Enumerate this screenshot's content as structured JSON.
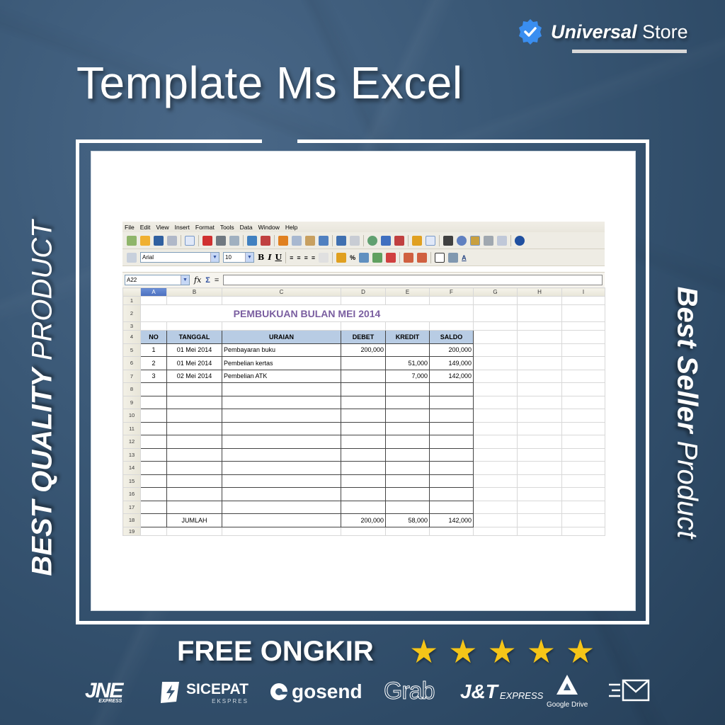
{
  "brand": {
    "name_bold": "Universal",
    "name_light": "Store",
    "badge_color": "#3a8ef0"
  },
  "title": "Template Ms Excel",
  "side_left": {
    "bold": "BEST QUALITY",
    "light": "PRODUCT"
  },
  "side_right": {
    "bold": "Best Seller",
    "light": "Product"
  },
  "spreadsheet": {
    "menu": [
      "File",
      "Edit",
      "View",
      "Insert",
      "Format",
      "Tools",
      "Data",
      "Window",
      "Help"
    ],
    "font_name": "Arial",
    "font_size": "10",
    "name_box": "A22",
    "formula_symbols": {
      "function": "fx",
      "sum": "Σ",
      "equals": "="
    },
    "columns": [
      "A",
      "B",
      "C",
      "D",
      "E",
      "F",
      "G",
      "H",
      "I"
    ],
    "selected_column": "A",
    "sheet_title": "PEMBUKUAN BULAN  MEI 2014",
    "headers": [
      "NO",
      "TANGGAL",
      "URAIAN",
      "DEBET",
      "KREDIT",
      "SALDO"
    ],
    "rows": [
      {
        "no": "1",
        "tanggal": "01 Mei 2014",
        "uraian": "Pembayaran buku",
        "debet": "200,000",
        "kredit": "",
        "saldo": "200,000"
      },
      {
        "no": "2",
        "tanggal": "01 Mei 2014",
        "uraian": "Pembelian kertas",
        "debet": "",
        "kredit": "51,000",
        "saldo": "149,000"
      },
      {
        "no": "3",
        "tanggal": "02 Mei 2014",
        "uraian": "Pembelian ATK",
        "debet": "",
        "kredit": "7,000",
        "saldo": "142,000"
      }
    ],
    "total": {
      "label": "JUMLAH",
      "debet": "200,000",
      "kredit": "58,000",
      "saldo": "142,000"
    },
    "row_numbers": [
      "1",
      "2",
      "3",
      "4",
      "5",
      "6",
      "7",
      "8",
      "9",
      "10",
      "11",
      "12",
      "13",
      "14",
      "15",
      "16",
      "17",
      "18",
      "19"
    ]
  },
  "free_ongkir": "FREE ONGKIR",
  "rating_stars": 5,
  "couriers": [
    {
      "name": "JNE",
      "sub": "EXPRESS"
    },
    {
      "name": "SICEPAT",
      "sub": "EKSPRES"
    },
    {
      "name": "gosend",
      "sub": ""
    },
    {
      "name": "Grab",
      "sub": ""
    },
    {
      "name": "J&T",
      "sub": "EXPRESS"
    },
    {
      "name": "",
      "sub": "Google Drive"
    },
    {
      "name": "",
      "sub": ""
    }
  ]
}
